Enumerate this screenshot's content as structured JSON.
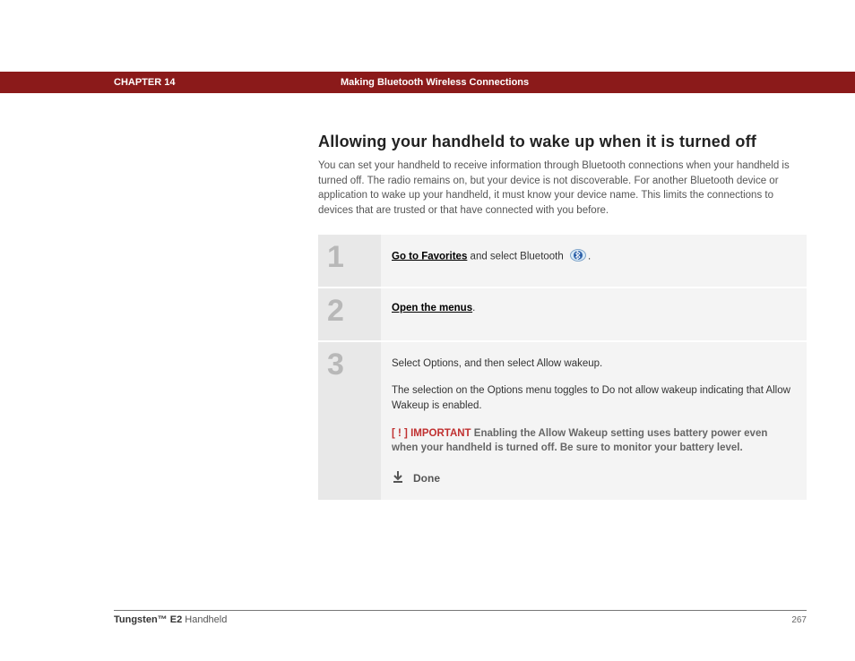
{
  "header": {
    "chapter_label": "CHAPTER 14",
    "chapter_title": "Making Bluetooth Wireless Connections"
  },
  "section": {
    "title": "Allowing your handheld to wake up when it is turned off",
    "intro": "You can set your handheld to receive information through Bluetooth connections when your handheld is turned off. The radio remains on, but your device is not discoverable. For another Bluetooth device or application to wake up your handheld, it must know your device name. This limits the connections to devices that are trusted or that have connected with you before."
  },
  "steps": {
    "s1": {
      "num": "1",
      "link": "Go to Favorites",
      "after": " and select Bluetooth ",
      "tail": "."
    },
    "s2": {
      "num": "2",
      "link": "Open the menus",
      "tail": "."
    },
    "s3": {
      "num": "3",
      "p1": "Select Options, and then select Allow wakeup.",
      "p2": "The selection on the Options menu toggles to Do not allow wakeup indicating that Allow Wakeup is enabled.",
      "important_tag": "[ ! ] IMPORTANT",
      "important_text": " Enabling the Allow Wakeup setting uses battery power even when your handheld is turned off. Be sure to monitor your battery level.",
      "done": "Done"
    }
  },
  "footer": {
    "product_bold": "Tungsten™ E2",
    "product_rest": " Handheld",
    "page_number": "267"
  }
}
